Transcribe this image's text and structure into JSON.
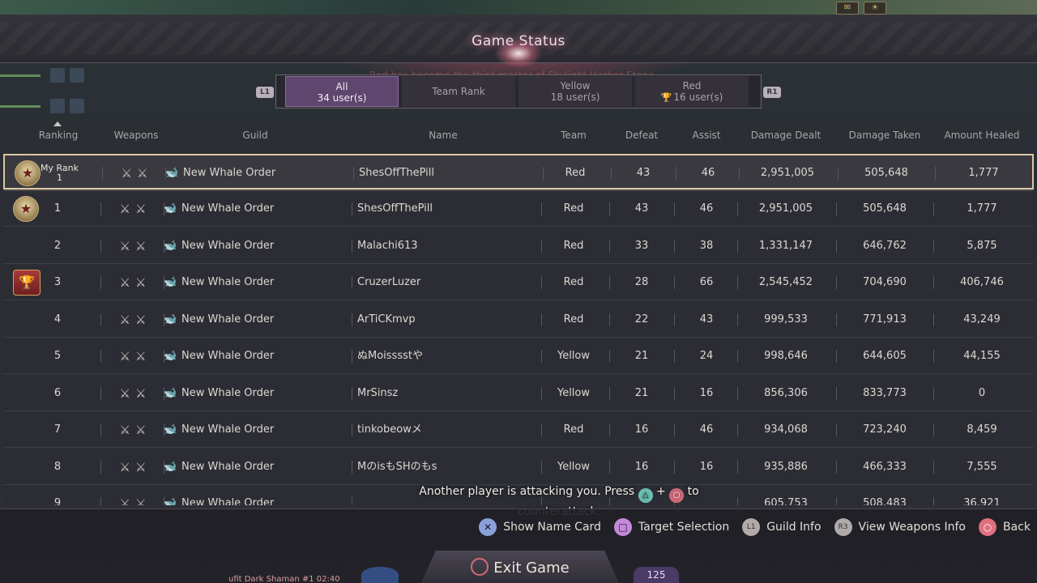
{
  "header": {
    "title": "Game Status"
  },
  "top_icons": [
    "✉",
    "☀"
  ],
  "faded_notice": "Red has become the third master of Skylight Harbor Stone",
  "tabs": [
    {
      "label": "All",
      "count": "34 user(s)"
    },
    {
      "label": "Team Rank",
      "count": ""
    },
    {
      "label": "Yellow",
      "count": "18 user(s)"
    },
    {
      "label": "Red",
      "count": "16 user(s)"
    }
  ],
  "shoulders": {
    "left": "L1",
    "right": "R1"
  },
  "columns": [
    "Ranking",
    "Weapons",
    "Guild",
    "Name",
    "Team",
    "Defeat",
    "Assist",
    "Damage Dealt",
    "Damage Taken",
    "Amount Healed"
  ],
  "my_rank": {
    "label": "My Rank",
    "rank": "1",
    "guild": "New Whale Order",
    "name": "ShesOffThePill",
    "team": "Red",
    "defeat": "43",
    "assist": "46",
    "dealt": "2,951,005",
    "taken": "505,648",
    "healed": "1,777"
  },
  "rows": [
    {
      "rank": "1",
      "guild": "New Whale Order",
      "name": "ShesOffThePill",
      "team": "Red",
      "defeat": "43",
      "assist": "46",
      "dealt": "2,951,005",
      "taken": "505,648",
      "healed": "1,777"
    },
    {
      "rank": "2",
      "guild": "New Whale Order",
      "name": "Malachi613",
      "team": "Red",
      "defeat": "33",
      "assist": "38",
      "dealt": "1,331,147",
      "taken": "646,762",
      "healed": "5,875"
    },
    {
      "rank": "3",
      "guild": "New Whale Order",
      "name": "CruzerLuzer",
      "team": "Red",
      "defeat": "28",
      "assist": "66",
      "dealt": "2,545,452",
      "taken": "704,690",
      "healed": "406,746"
    },
    {
      "rank": "4",
      "guild": "New Whale Order",
      "name": "ArTiCKmvp",
      "team": "Red",
      "defeat": "22",
      "assist": "43",
      "dealt": "999,533",
      "taken": "771,913",
      "healed": "43,249"
    },
    {
      "rank": "5",
      "guild": "New Whale Order",
      "name": "ぬMoisssstや",
      "team": "Yellow",
      "defeat": "21",
      "assist": "24",
      "dealt": "998,646",
      "taken": "644,605",
      "healed": "44,155"
    },
    {
      "rank": "6",
      "guild": "New Whale Order",
      "name": "MrSinsz",
      "team": "Yellow",
      "defeat": "21",
      "assist": "16",
      "dealt": "856,306",
      "taken": "833,773",
      "healed": "0"
    },
    {
      "rank": "7",
      "guild": "New Whale Order",
      "name": "tinkobeowメ",
      "team": "Red",
      "defeat": "16",
      "assist": "46",
      "dealt": "934,068",
      "taken": "723,240",
      "healed": "8,459"
    },
    {
      "rank": "8",
      "guild": "New Whale Order",
      "name": "MのisもSHのもs",
      "team": "Yellow",
      "defeat": "16",
      "assist": "16",
      "dealt": "935,886",
      "taken": "466,333",
      "healed": "7,555"
    },
    {
      "rank": "9",
      "guild": "New Whale Order",
      "name": "",
      "team": "",
      "defeat": "",
      "assist": "",
      "dealt": "605,753",
      "taken": "508,483",
      "healed": "36,921"
    }
  ],
  "prompt": {
    "line1a": "Another player is attacking you. Press",
    "plus": "+",
    "line1b": "to",
    "line2": "counterattack."
  },
  "hints": [
    {
      "button": "✕",
      "label": "Show Name Card"
    },
    {
      "button": "□",
      "label": "Target Selection"
    },
    {
      "button": "L1",
      "label": "Guild Info"
    },
    {
      "button": "R3",
      "label": "View Weapons Info"
    },
    {
      "button": "○",
      "label": "Back"
    }
  ],
  "exit": {
    "label": "Exit Game"
  },
  "badge": "125",
  "corner_text": "ufit Dark Shaman #1 02:40",
  "icons": {
    "weapons": "⚔",
    "guild": "🐋",
    "medal": "★",
    "trophy": "🏆"
  }
}
